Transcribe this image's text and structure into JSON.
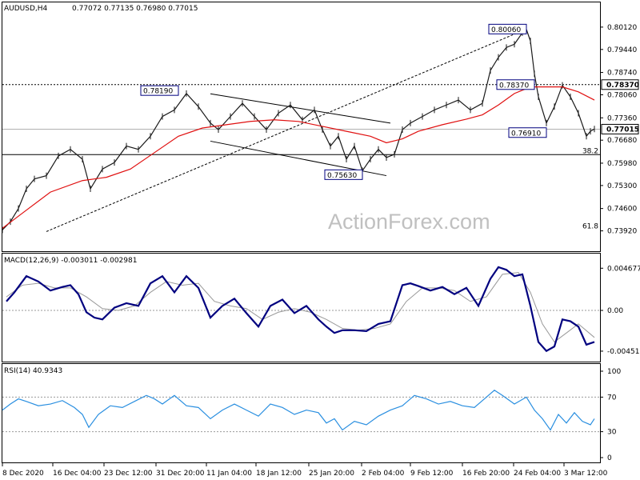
{
  "header": {
    "symbol": "AUDUSD,H4",
    "ohlc": "0.77072 0.77135 0.76980 0.77015"
  },
  "watermark": "ActionForex.com",
  "colors": {
    "price": "#1a1a1a",
    "sma": "#e01010",
    "macd": "#00007f",
    "signal": "#999999",
    "rsi": "#2a8fe0",
    "level_box": "#00007f",
    "price_box": "#000000"
  },
  "chart_data": [
    {
      "type": "line",
      "panel": "price",
      "title": "AUDUSD,H4",
      "ylim": [
        0.7335,
        0.8075
      ],
      "yticks": [
        "0.80120",
        "0.79440",
        "0.78740",
        "0.78060",
        "0.77360",
        "0.76680",
        "0.75980",
        "0.75300",
        "0.74600",
        "0.73920"
      ],
      "xlabels": [
        "8 Dec 2020",
        "16 Dec 04:00",
        "23 Dec 12:00",
        "31 Dec 20:00",
        "11 Jan 04:00",
        "18 Jan 12:00",
        "25 Jan 20:00",
        "2 Feb 04:00",
        "9 Feb 12:00",
        "16 Feb 20:00",
        "24 Feb 04:00",
        "3 Mar 12:00"
      ],
      "series": [
        {
          "name": "AUDUSD,H4",
          "x": [
            0,
            10,
            20,
            30,
            40,
            55,
            70,
            85,
            100,
            110,
            125,
            140,
            155,
            170,
            185,
            200,
            215,
            230,
            245,
            260,
            270,
            285,
            300,
            315,
            330,
            345,
            360,
            375,
            390,
            400,
            410,
            420,
            430,
            440,
            450,
            460,
            470,
            480,
            490,
            500,
            510,
            525,
            540,
            555,
            570,
            585,
            600,
            610,
            620,
            630,
            640,
            650,
            655,
            660,
            665,
            670,
            680,
            690,
            700,
            710,
            720,
            730,
            735,
            740
          ],
          "values": [
            0.7395,
            0.742,
            0.746,
            0.752,
            0.755,
            0.756,
            0.762,
            0.764,
            0.761,
            0.752,
            0.758,
            0.76,
            0.765,
            0.764,
            0.768,
            0.774,
            0.776,
            0.781,
            0.777,
            0.772,
            0.77,
            0.774,
            0.778,
            0.774,
            0.77,
            0.775,
            0.7775,
            0.773,
            0.776,
            0.77,
            0.765,
            0.768,
            0.761,
            0.765,
            0.7575,
            0.761,
            0.764,
            0.7615,
            0.7625,
            0.77,
            0.772,
            0.774,
            0.776,
            0.7775,
            0.779,
            0.776,
            0.778,
            0.788,
            0.792,
            0.795,
            0.796,
            0.7995,
            0.8005,
            0.797,
            0.787,
            0.78,
            0.772,
            0.777,
            0.7835,
            0.78,
            0.775,
            0.768,
            0.7695,
            0.7702
          ]
        },
        {
          "name": "SMA",
          "x": [
            0,
            30,
            60,
            100,
            130,
            160,
            190,
            220,
            250,
            280,
            310,
            340,
            370,
            400,
            430,
            460,
            480,
            500,
            520,
            550,
            580,
            600,
            620,
            640,
            660,
            680,
            700,
            720,
            740
          ],
          "values": [
            0.74,
            0.7455,
            0.751,
            0.7545,
            0.7555,
            0.758,
            0.763,
            0.768,
            0.7705,
            0.7715,
            0.7725,
            0.773,
            0.7725,
            0.771,
            0.7695,
            0.768,
            0.766,
            0.7672,
            0.7695,
            0.7715,
            0.7732,
            0.7745,
            0.7775,
            0.781,
            0.783,
            0.783,
            0.783,
            0.7815,
            0.779
          ]
        }
      ],
      "levels": [
        {
          "label": "0.80060",
          "x": 655,
          "value": 0.8006
        },
        {
          "label": "0.78190",
          "x": 220,
          "value": 0.7819
        },
        {
          "label": "0.78370",
          "x": 665,
          "value": 0.7837
        },
        {
          "label": "0.76910",
          "x": 680,
          "value": 0.7691
        },
        {
          "label": "0.75630",
          "x": 450,
          "value": 0.7563
        }
      ],
      "price_tags": [
        {
          "label": "0.78370",
          "value": 0.7837
        },
        {
          "label": "0.77015",
          "value": 0.77015
        }
      ],
      "horizontal_lines": [
        {
          "value": 0.7837,
          "style": "dotted"
        },
        {
          "value": 0.77015,
          "style": "solid-light"
        },
        {
          "value": 0.7624,
          "style": "solid"
        }
      ],
      "fib_labels": [
        {
          "label": "38.2",
          "value": 0.7624
        },
        {
          "label": "61.8",
          "value": 0.7395
        }
      ],
      "channel": {
        "upper": [
          {
            "x": 260,
            "value": 0.7809
          },
          {
            "x": 485,
            "value": 0.772
          }
        ],
        "lower": [
          {
            "x": 260,
            "value": 0.7665
          },
          {
            "x": 480,
            "value": 0.756
          }
        ]
      },
      "trendline": [
        {
          "x": 55,
          "value": 0.739
        },
        {
          "x": 655,
          "value": 0.8006
        }
      ]
    },
    {
      "type": "line",
      "panel": "macd",
      "title": "MACD(12,26,9) -0.003011 -0.002981",
      "ylim": [
        -0.0055,
        0.0055
      ],
      "yticks": [
        "0.004677",
        "0.00",
        "-0.004519"
      ],
      "series": [
        {
          "name": "MACD",
          "x": [
            5,
            15,
            30,
            45,
            60,
            75,
            85,
            95,
            105,
            115,
            125,
            140,
            155,
            170,
            185,
            200,
            215,
            230,
            245,
            260,
            275,
            290,
            305,
            320,
            335,
            350,
            365,
            380,
            395,
            405,
            415,
            425,
            440,
            455,
            470,
            485,
            500,
            510,
            520,
            535,
            550,
            565,
            580,
            595,
            610,
            620,
            630,
            640,
            650,
            660,
            670,
            680,
            690,
            700,
            710,
            720,
            730,
            740
          ],
          "values": [
            0.001,
            0.002,
            0.0038,
            0.0032,
            0.0022,
            0.0026,
            0.0028,
            0.0018,
            -0.0002,
            -0.0008,
            -0.001,
            0.0003,
            0.0008,
            0.0005,
            0.003,
            0.0038,
            0.002,
            0.0038,
            0.0025,
            -0.0008,
            0.0005,
            0.0013,
            -0.0003,
            -0.0018,
            0.0005,
            0.0012,
            -0.0003,
            0.0005,
            -0.001,
            -0.0018,
            -0.0025,
            -0.0022,
            -0.0022,
            -0.0023,
            -0.0015,
            -0.0012,
            0.0028,
            0.003,
            0.0027,
            0.0022,
            0.0026,
            0.0018,
            0.0025,
            0.0005,
            0.0035,
            0.0048,
            0.0045,
            0.0038,
            0.004,
            0.0005,
            -0.0035,
            -0.0045,
            -0.004,
            -0.001,
            -0.0012,
            -0.0018,
            -0.0038,
            -0.0035
          ]
        },
        {
          "name": "Signal",
          "x": [
            5,
            25,
            45,
            65,
            85,
            105,
            125,
            145,
            165,
            185,
            205,
            225,
            245,
            265,
            285,
            305,
            325,
            345,
            365,
            385,
            405,
            425,
            445,
            465,
            485,
            505,
            525,
            545,
            565,
            585,
            605,
            625,
            645,
            660,
            675,
            690,
            705,
            720,
            740
          ],
          "values": [
            0.0015,
            0.0028,
            0.003,
            0.0025,
            0.0025,
            0.0015,
            0.0002,
            0.0,
            0.0005,
            0.002,
            0.0032,
            0.0028,
            0.003,
            0.001,
            0.0005,
            0.0002,
            -0.001,
            -0.0002,
            0.0002,
            -0.0002,
            -0.001,
            -0.002,
            -0.0022,
            -0.002,
            -0.0015,
            0.001,
            0.0025,
            0.0025,
            0.0022,
            0.001,
            0.0015,
            0.004,
            0.0042,
            0.002,
            -0.0015,
            -0.0035,
            -0.0025,
            -0.0015,
            -0.003
          ]
        }
      ]
    },
    {
      "type": "line",
      "panel": "rsi",
      "title": "RSI(14) 40.9343",
      "ylim": [
        0,
        100
      ],
      "yticks": [
        "100",
        "70",
        "30",
        "0"
      ],
      "series": [
        {
          "name": "RSI",
          "x": [
            0,
            10,
            20,
            30,
            45,
            60,
            75,
            90,
            100,
            108,
            120,
            135,
            150,
            165,
            180,
            190,
            200,
            215,
            230,
            245,
            260,
            275,
            290,
            305,
            320,
            335,
            350,
            365,
            380,
            395,
            405,
            415,
            425,
            440,
            455,
            470,
            485,
            500,
            515,
            530,
            545,
            560,
            575,
            590,
            605,
            615,
            625,
            640,
            655,
            665,
            675,
            685,
            695,
            705,
            715,
            725,
            735,
            740
          ],
          "values": [
            55,
            62,
            68,
            65,
            60,
            62,
            66,
            58,
            50,
            35,
            50,
            60,
            58,
            65,
            72,
            68,
            62,
            72,
            60,
            58,
            45,
            55,
            62,
            55,
            48,
            62,
            58,
            50,
            55,
            52,
            40,
            45,
            32,
            42,
            38,
            48,
            55,
            60,
            72,
            68,
            62,
            65,
            60,
            58,
            70,
            78,
            72,
            62,
            70,
            55,
            45,
            32,
            50,
            40,
            52,
            42,
            38,
            45
          ]
        }
      ],
      "levels": [
        70,
        30
      ]
    }
  ]
}
